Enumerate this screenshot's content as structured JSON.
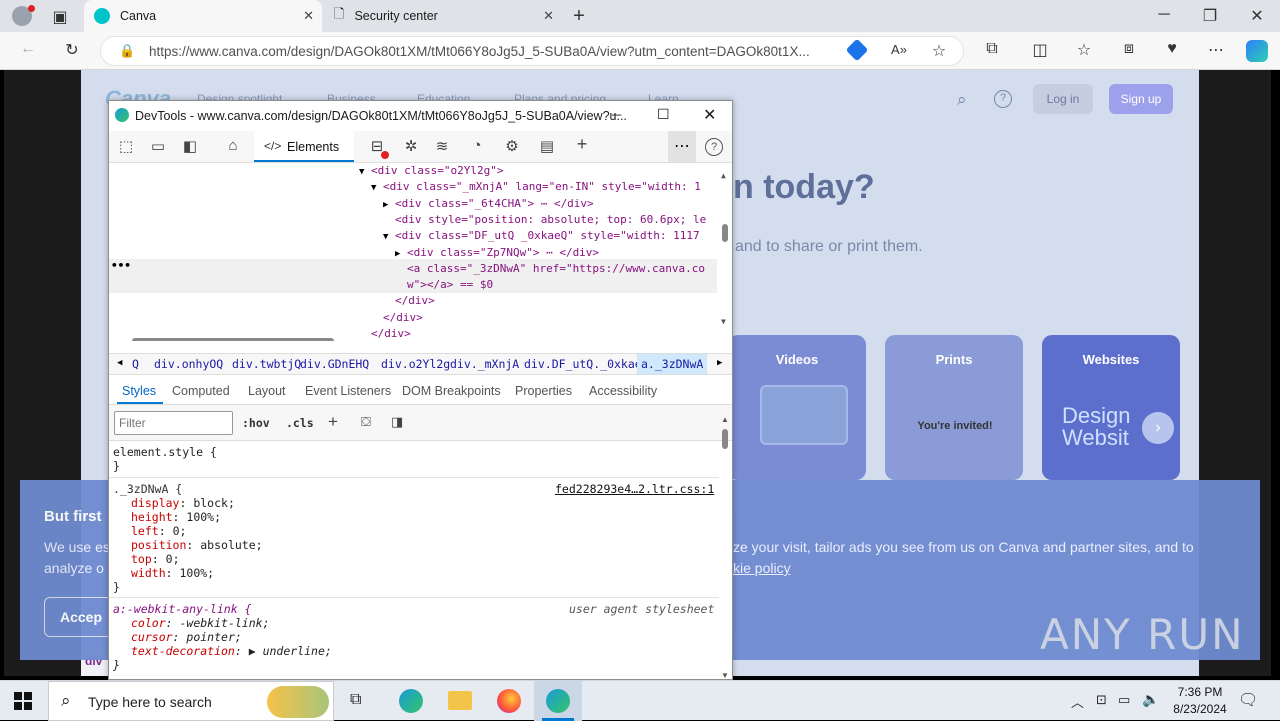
{
  "browser": {
    "tabs": [
      {
        "title": "Canva",
        "active": true
      },
      {
        "title": "Security center",
        "active": false
      }
    ],
    "url": "https://www.canva.com/design/DAGOk80t1XM/tMt066Y8oJg5J_5-SUBa0A/view?utm_content=DAGOk80t1X..."
  },
  "canva": {
    "logo": "Canva",
    "nav": [
      "Design spotlight",
      "Business",
      "Education",
      "Plans and pricing",
      "Learn"
    ],
    "login": "Log in",
    "signup": "Sign up",
    "headline": "n today?",
    "subtext": "and to share or print them.",
    "cards": [
      "Videos",
      "Prints",
      "Websites"
    ],
    "prints_card_text": "You're invited!",
    "websites_card_text": "Design Websit",
    "cookie_title": "But first",
    "cookie_text_left": "We use es",
    "cookie_text_left2": "analyze o",
    "cookie_text_right": "ze your visit, tailor ads you see from us on Canva and partner sites, and to",
    "cookie_link": "kie policy",
    "accept": "Accep",
    "bottom_tag": "div"
  },
  "devtools": {
    "title": "DevTools - www.canva.com/design/DAGOk80t1XM/tMt066Y8oJg5J_5-SUBa0A/view?u...",
    "active_tool": "Elements",
    "dom_lines": [
      {
        "indent": 0,
        "arrow": "▼",
        "text": "<div class=\"o2Yl2g\">"
      },
      {
        "indent": 1,
        "arrow": "▼",
        "text": "<div class=\"_mXnjA\" lang=\"en-IN\" style=\"width: 1"
      },
      {
        "indent": 2,
        "arrow": "▶",
        "text": "<div class=\"_6t4CHA\"> ⋯ </div>"
      },
      {
        "indent": 2,
        "arrow": "",
        "text": "<div style=\"position: absolute; top: 60.6px; le"
      },
      {
        "indent": 2,
        "arrow": "▼",
        "text": "<div class=\"DF_utQ _0xkaeQ\" style=\"width: 1117"
      },
      {
        "indent": 3,
        "arrow": "▶",
        "text": "<div class=\"Zp7NQw\"> ⋯ </div>"
      },
      {
        "indent": 3,
        "arrow": "",
        "text": "<a class=\"_3zDNwA\" href=\"https://www.canva.co"
      },
      {
        "indent": 3,
        "arrow": "",
        "text": "w\"></a> == $0"
      },
      {
        "indent": 2,
        "arrow": "",
        "text": "</div>"
      },
      {
        "indent": 1,
        "arrow": "",
        "text": "</div>"
      },
      {
        "indent": 0,
        "arrow": "",
        "text": "</div>"
      }
    ],
    "breadcrumbs": [
      "Q",
      "div.onhyOQ",
      "div.twbtjQ",
      "div.GDnEHQ",
      "div.o2Yl2g",
      "div._mXnjA",
      "div.DF_utQ._0xkaeQ",
      "a._3zDNwA"
    ],
    "subtabs": [
      "Styles",
      "Computed",
      "Layout",
      "Event Listeners",
      "DOM Breakpoints",
      "Properties",
      "Accessibility"
    ],
    "filter_placeholder": "Filter",
    "filter_buttons": [
      ":hov",
      ".cls"
    ],
    "element_style": "element.style {",
    "rule1_selector": "._3zDNwA {",
    "rule1_source": "fed228293e4…2.ltr.css:1",
    "rule1_props": [
      {
        "name": "display",
        "value": "block;"
      },
      {
        "name": "height",
        "value": "100%;"
      },
      {
        "name": "left",
        "value": "0;"
      },
      {
        "name": "position",
        "value": "absolute;"
      },
      {
        "name": "top",
        "value": "0;"
      },
      {
        "name": "width",
        "value": "100%;"
      }
    ],
    "rule2_selector": "a:-webkit-any-link {",
    "rule2_source": "user agent stylesheet",
    "rule2_props": [
      {
        "name": "color",
        "value": "-webkit-link;"
      },
      {
        "name": "cursor",
        "value": "pointer;"
      },
      {
        "name": "text-decoration",
        "value": "▶ underline;"
      }
    ],
    "close_brace": "}"
  },
  "taskbar": {
    "search_placeholder": "Type here to search",
    "time": "7:36 PM",
    "date": "8/23/2024"
  },
  "watermark": "ANY RUN",
  "colors": {
    "accent": "#0078d4",
    "canva_purple": "#8b3dff"
  }
}
